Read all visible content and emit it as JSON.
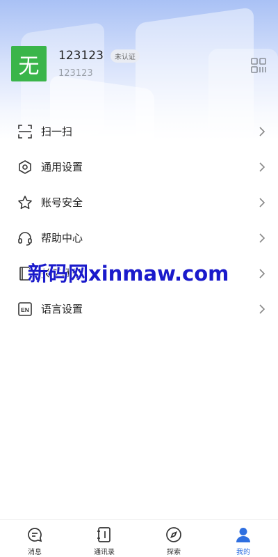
{
  "profile": {
    "avatar_char": "无",
    "username": "123123",
    "badge": "未认证",
    "account_id": "123123"
  },
  "menu": {
    "items": [
      {
        "label": "扫一扫",
        "icon": "scan-icon"
      },
      {
        "label": "通用设置",
        "icon": "hexagon-settings-icon"
      },
      {
        "label": "账号安全",
        "icon": "star-icon"
      },
      {
        "label": "帮助中心",
        "icon": "headset-icon"
      },
      {
        "label": "关于我们",
        "icon": "book-icon"
      },
      {
        "label": "语言设置",
        "icon": "en-language-icon"
      }
    ]
  },
  "watermark": "新码网xinmaw.com",
  "tabs": [
    {
      "label": "消息",
      "icon": "chat-icon"
    },
    {
      "label": "通讯录",
      "icon": "contacts-icon"
    },
    {
      "label": "探索",
      "icon": "compass-icon"
    },
    {
      "label": "我的",
      "icon": "person-icon"
    }
  ],
  "colors": {
    "accent": "#2f6fe0",
    "avatar_bg": "#3ab54a",
    "watermark": "#1a1acb"
  }
}
